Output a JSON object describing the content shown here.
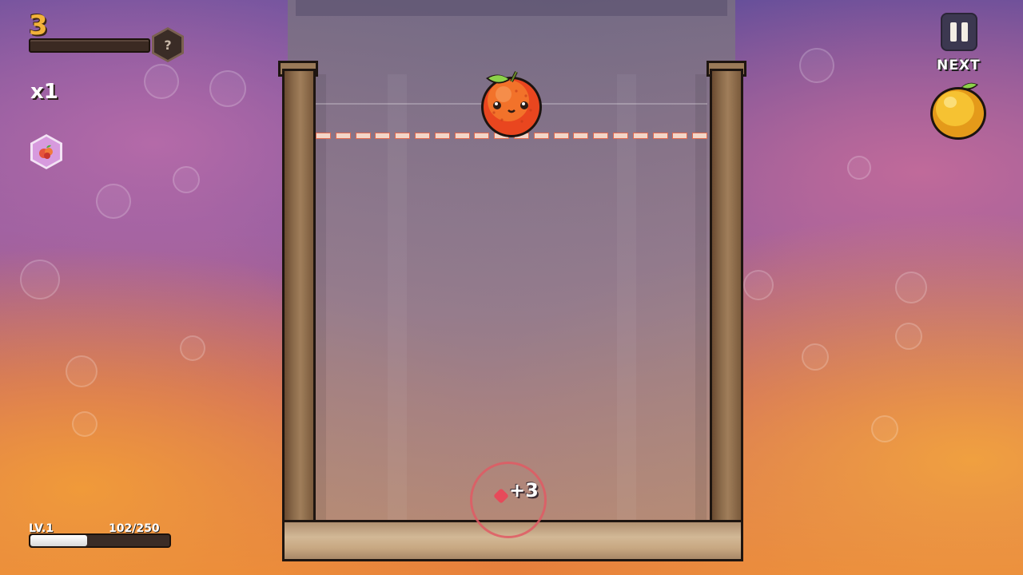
{
  "hud": {
    "score": "3",
    "unknown_badge": "?",
    "multiplier": "x1",
    "next_label": "NEXT",
    "level_label": "LV.1",
    "xp_count": "102/250",
    "xp_progress": 0.408
  },
  "game": {
    "current_fruit": "orange",
    "next_fruit": "lemon",
    "score_popup": "+3"
  },
  "icons": {
    "pause": "pause-icon",
    "powerup": "fruit-cluster-icon",
    "unknown": "question-icon"
  },
  "colors": {
    "score": "#f2b23a",
    "drop_line": "#e06a50",
    "wood": "#a07e5a",
    "popup_ring": "#e15a64"
  }
}
